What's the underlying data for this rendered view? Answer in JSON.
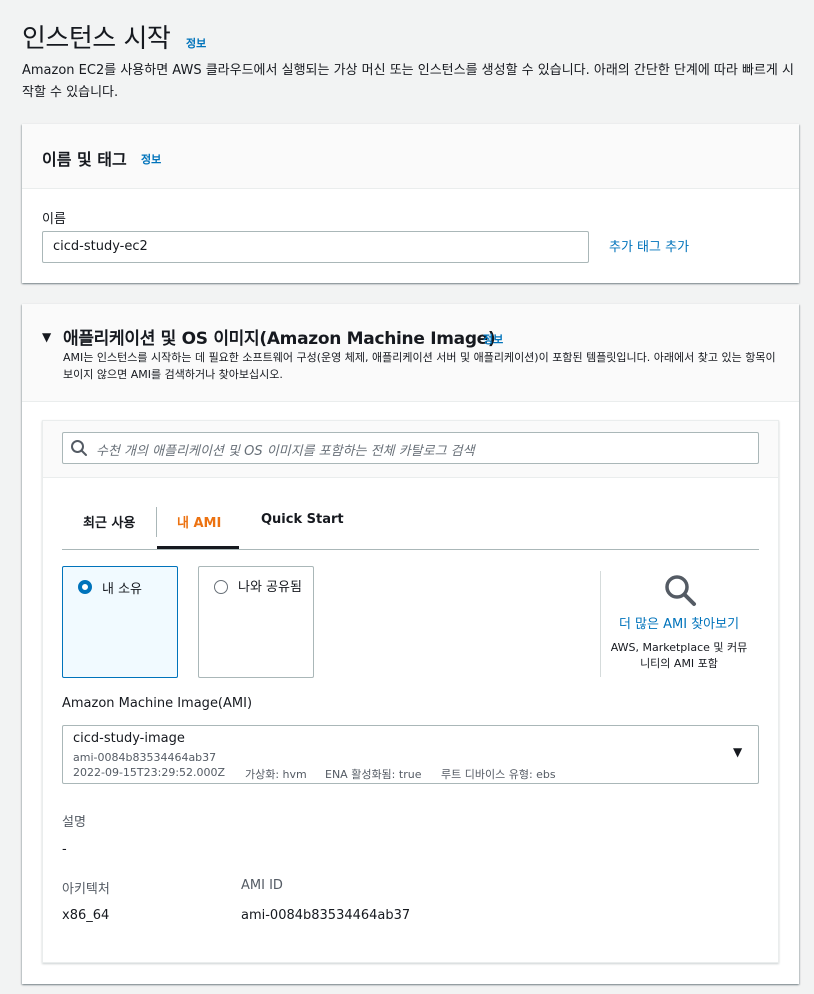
{
  "page": {
    "title": "인스턴스 시작",
    "info": "정보",
    "description": "Amazon EC2를 사용하면 AWS 클라우드에서 실행되는 가상 머신 또는 인스턴스를 생성할 수 있습니다. 아래의 간단한 단계에 따라 빠르게 시작할 수 있습니다."
  },
  "name_tags": {
    "title": "이름 및 태그",
    "info": "정보",
    "name_label": "이름",
    "name_value": "cicd-study-ec2",
    "add_tag": "추가 태그 추가"
  },
  "ami": {
    "title": "애플리케이션 및 OS 이미지(Amazon Machine Image)",
    "info": "정보",
    "description": "AMI는 인스턴스를 시작하는 데 필요한 소프트웨어 구성(운영 체제, 애플리케이션 서버 및 애플리케이션)이 포함된 템플릿입니다. 아래에서 찾고 있는 항목이 보이지 않으면 AMI를 검색하거나 찾아보십시오.",
    "search_placeholder": "수천 개의 애플리케이션 및 OS 이미지를 포함하는 전체 카탈로그 검색",
    "tabs": [
      "최근 사용",
      "내 AMI",
      "Quick Start"
    ],
    "active_tab": "내 AMI",
    "owned_label": "내 소유",
    "shared_label": "나와 공유됨",
    "more_link": "더 많은 AMI 찾아보기",
    "more_sub": "AWS, Marketplace 및 커뮤니티의 AMI 포함",
    "select_label": "Amazon Machine Image(AMI)",
    "selected": {
      "name": "cicd-study-image",
      "id": "ami-0084b83534464ab37",
      "date": "2022-09-15T23:29:52.000Z",
      "virtualization": "가상화: hvm",
      "ena": "ENA 활성화됨: true",
      "root_device": "루트 디바이스 유형: ebs"
    },
    "desc_label": "설명",
    "desc_value": "-",
    "arch_label": "아키텍처",
    "arch_value": "x86_64",
    "amiid_label": "AMI ID",
    "amiid_value": "ami-0084b83534464ab37"
  },
  "colors": {
    "link": "#0073bb",
    "active_tab": "#ec7211",
    "selected_tile_bg": "#f1faff"
  }
}
